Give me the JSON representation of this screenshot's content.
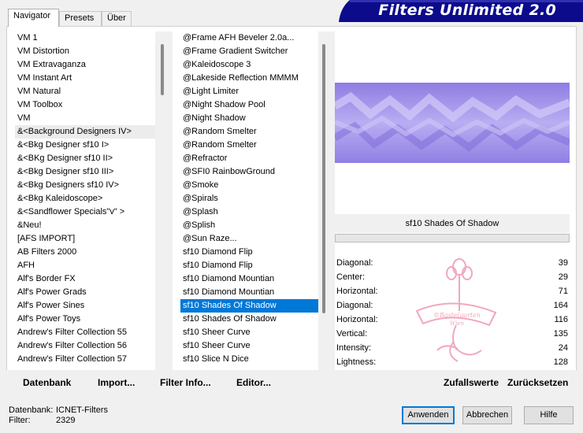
{
  "tabs": [
    "Navigator",
    "Presets",
    "Über"
  ],
  "app_title": "Filters Unlimited 2.0",
  "categories": [
    "VM 1",
    "VM Distortion",
    "VM Extravaganza",
    "VM Instant Art",
    "VM Natural",
    "VM Toolbox",
    "VM",
    "&<Background Designers IV>",
    "&<Bkg Designer sf10 I>",
    "&<BKg Designer sf10 II>",
    "&<Bkg Designer sf10 III>",
    "&<Bkg Designers sf10 IV>",
    "&<Bkg Kaleidoscope>",
    "&<Sandflower Specials\"v\" >",
    "&Neu!",
    "[AFS IMPORT]",
    "AB Filters 2000",
    "AFH",
    "Alf's Border FX",
    "Alf's Power Grads",
    "Alf's Power Sines",
    "Alf's Power Toys",
    "Andrew's Filter Collection 55",
    "Andrew's Filter Collection 56",
    "Andrew's Filter Collection 57"
  ],
  "filters": [
    "@Frame AFH Beveler 2.0a...",
    "@Frame Gradient Switcher",
    "@Kaleidoscope 3",
    "@Lakeside Reflection MMMM",
    "@Light Limiter",
    "@Night Shadow Pool",
    "@Night Shadow",
    "@Random Smelter",
    "@Random Smelter",
    "@Refractor",
    "@SFI0 RainbowGround",
    "@Smoke",
    "@Spirals",
    "@Splash",
    "@Splish",
    "@Sun Raze...",
    "sf10 Diamond Flip",
    "sf10 Diamond Flip",
    "sf10 Diamond Mountian",
    "sf10 Diamond Mountian",
    "sf10 Shades Of Shadow",
    "sf10 Shades Of Shadow",
    "sf10 Sheer Curve",
    "sf10 Sheer Curve",
    "sf10 Slice N Dice"
  ],
  "selected_filter_name": "sf10 Shades Of Shadow",
  "parameters": [
    {
      "label": "Diagonal:",
      "value": "39"
    },
    {
      "label": "Center:",
      "value": "29"
    },
    {
      "label": "Horizontal:",
      "value": "71"
    },
    {
      "label": "Diagonal:",
      "value": "164"
    },
    {
      "label": "Horizontal:",
      "value": "116"
    },
    {
      "label": "Vertical:",
      "value": "135"
    },
    {
      "label": "Intensity:",
      "value": "24"
    },
    {
      "label": "Lightness:",
      "value": "128"
    }
  ],
  "watermark_text": [
    "©Bastelgarten",
    "Wien"
  ],
  "actions": {
    "database": "Datenbank",
    "import": "Import...",
    "filter_info": "Filter Info...",
    "editor": "Editor...",
    "randomize": "Zufallswerte",
    "reset": "Zurücksetzen"
  },
  "footer": {
    "db_label": "Datenbank:",
    "db_value": "ICNET-Filters",
    "filter_label": "Filter:",
    "filter_value": "2329"
  },
  "buttons": {
    "apply": "Anwenden",
    "cancel": "Abbrechen",
    "help": "Hilfe"
  },
  "colors": {
    "accent": "#0078d7",
    "banner": "#0b0b8c",
    "preview": "#a394ea",
    "watermark": "#f0a8bc"
  }
}
